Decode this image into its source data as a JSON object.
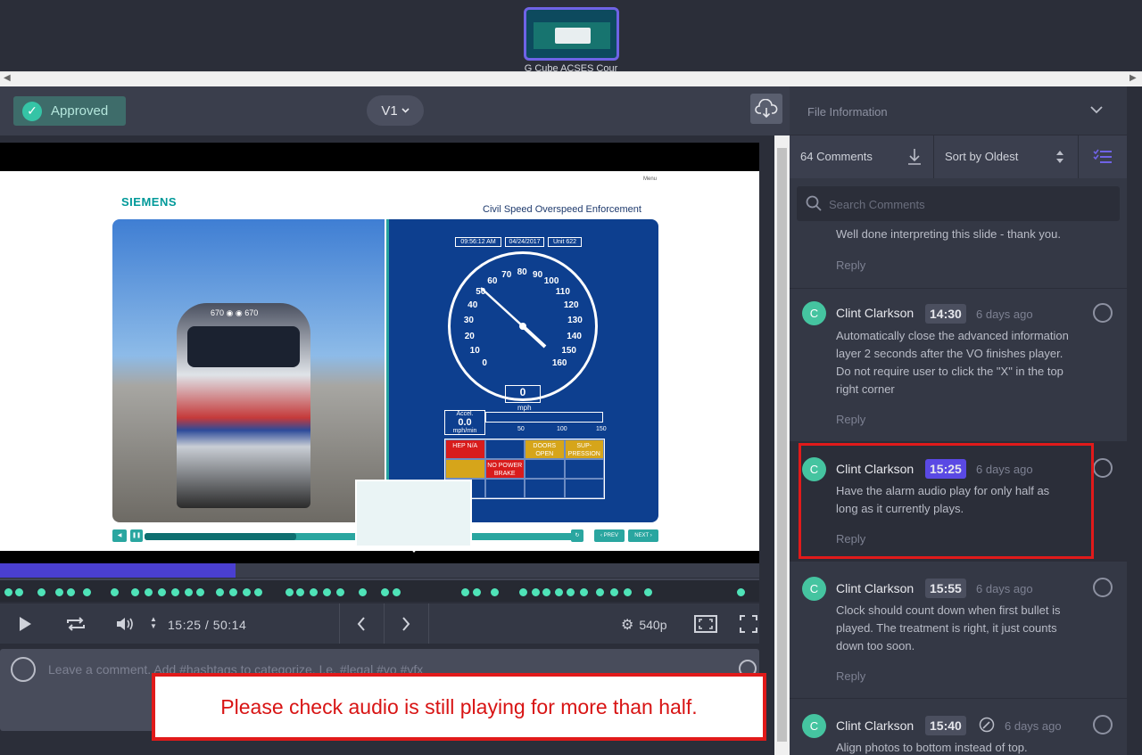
{
  "filmstrip": {
    "thumbnail_label": "G Cube ACSES Cour"
  },
  "toolbar": {
    "status_label": "Approved",
    "version_label": "V1"
  },
  "slide": {
    "brand": "SIEMENS",
    "menu": "Menu",
    "title": "Civil Speed Overspeed Enforcement",
    "loco_number": "670 ◉ ◉ 670",
    "time_box": "09:56:12 AM",
    "date_box": "04/24/2017",
    "unit_box": "Unit 622",
    "speed_value": "0",
    "speed_unit": "mph",
    "accel_label": "Accel.",
    "accel_value": "0.0",
    "accel_unit": "mph/min",
    "scale": [
      "50",
      "100",
      "150"
    ],
    "gauge_labels": [
      "0",
      "10",
      "20",
      "30",
      "40",
      "50",
      "60",
      "70",
      "80",
      "90",
      "100",
      "110",
      "120",
      "130",
      "140",
      "150",
      "160"
    ],
    "cells": [
      "HEP N/A",
      "",
      "DOORS OPEN",
      "SUP-PRESSION",
      "",
      "NO POWER BRAKE",
      "",
      ""
    ],
    "prev": "‹ PREV",
    "next": "NEXT ›"
  },
  "playback": {
    "progress_fraction": 0.31,
    "current_time": "15:25",
    "total_time": "50:14",
    "quality": "540p"
  },
  "composer": {
    "placeholder": "Leave a comment. Add #hashtags to categorize, I.e. #legal #vo #vfx"
  },
  "annotation": {
    "text": "Please check audio is still playing for more than half."
  },
  "panel": {
    "file_info_label": "File Information",
    "comment_count": "64 Comments",
    "sort_label": "Sort by Oldest",
    "search_placeholder": "Search Comments",
    "reply_label": "Reply",
    "partial_comment": "Well done interpreting this slide - thank you.",
    "comments": [
      {
        "initial": "C",
        "author": "Clint Clarkson",
        "time": "14:30",
        "ago": "6 days ago",
        "body": "Automatically close the advanced information layer 2 seconds after the VO finishes player. Do not require user to click the \"X\" in the top right corner"
      },
      {
        "initial": "C",
        "author": "Clint Clarkson",
        "time": "15:25",
        "ago": "6 days ago",
        "body": "Have the alarm audio play for only half as long as it currently plays."
      },
      {
        "initial": "C",
        "author": "Clint Clarkson",
        "time": "15:55",
        "ago": "6 days ago",
        "body": "Clock should count down when first bullet is played. The treatment is right, it just counts down too soon."
      },
      {
        "initial": "C",
        "author": "Clint Clarkson",
        "time": "15:40",
        "ago": "6 days ago",
        "body": "Align photos to bottom instead of top."
      }
    ]
  },
  "colors": {
    "accent": "#5a49e4",
    "marker": "#4fe3b8",
    "approved": "#35c4a6",
    "annotation": "#e11a1a"
  },
  "icons": [
    "checkmark-icon",
    "chevron-down-icon",
    "cloud-download-icon",
    "play-icon",
    "loop-icon",
    "volume-icon",
    "prev-icon",
    "next-icon",
    "gear-icon",
    "fit-screen-icon",
    "fullscreen-icon",
    "user-icon",
    "emoji-icon",
    "download-icon",
    "sort-icon",
    "filter-list-icon",
    "search-icon",
    "draw-icon"
  ]
}
